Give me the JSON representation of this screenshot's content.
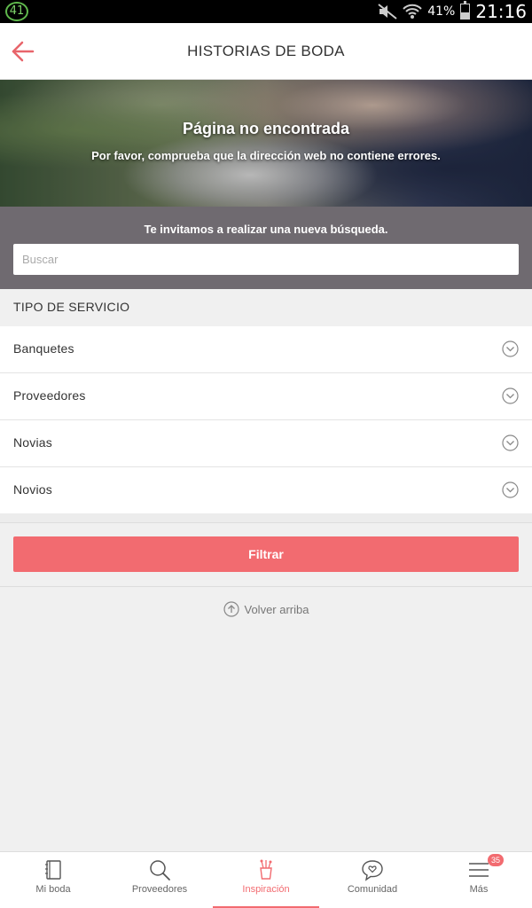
{
  "status_bar": {
    "notification_count": "41",
    "battery": "41%",
    "time": "21:16"
  },
  "app_bar": {
    "title": "HISTORIAS DE BODA"
  },
  "hero": {
    "title": "Página no encontrada",
    "subtitle": "Por favor, comprueba que la dirección web no contiene errores."
  },
  "search": {
    "prompt": "Te invitamos a realizar una nueva búsqueda.",
    "placeholder": "Buscar",
    "value": ""
  },
  "filters": {
    "section_title": "TIPO DE SERVICIO",
    "items": [
      {
        "label": "Banquetes"
      },
      {
        "label": "Proveedores"
      },
      {
        "label": "Novias"
      },
      {
        "label": "Novios"
      }
    ],
    "filter_button": "Filtrar"
  },
  "back_to_top": "Volver arriba",
  "bottom_nav": {
    "items": [
      {
        "label": "Mi boda",
        "icon": "notebook-icon"
      },
      {
        "label": "Proveedores",
        "icon": "search-icon"
      },
      {
        "label": "Inspiración",
        "icon": "inspiration-icon"
      },
      {
        "label": "Comunidad",
        "icon": "chat-heart-icon"
      },
      {
        "label": "Más",
        "icon": "menu-icon"
      }
    ],
    "badge": "35",
    "active_index": 2
  },
  "colors": {
    "accent": "#f26b70",
    "search_band": "#6f6a70"
  }
}
